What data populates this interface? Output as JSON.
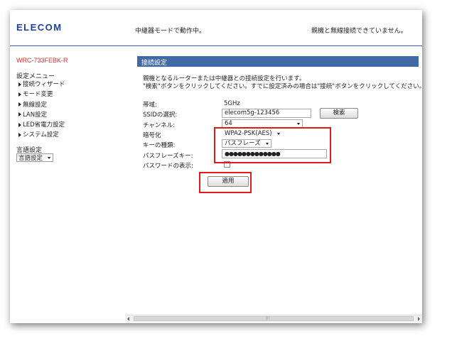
{
  "header": {
    "logo": "ELECOM",
    "mode_status": "中継器モードで動作中。",
    "connection_status": "親機と無線接続できていません。"
  },
  "sidebar": {
    "model": "WRC-733FEBK-R",
    "menu_title": "設定メニュー",
    "items": [
      {
        "label": "接続ウィザード"
      },
      {
        "label": "モード変更"
      },
      {
        "label": "無線設定"
      },
      {
        "label": "LAN設定"
      },
      {
        "label": "LED省電力設定"
      },
      {
        "label": "システム設定"
      }
    ],
    "language_label": "言語設定",
    "language_select": "言語設定"
  },
  "main": {
    "section_title": "接続設定",
    "description_line1": "親機となるルーターまたは中継器との接続設定を行います。",
    "description_line2": "\"検索\"ボタンをクリックしてください。すでに設定済みの場合は\"接続\"ボタンをクリックしてください。",
    "band_label": "帯域:",
    "band_value": "5GHz",
    "ssid_label": "SSIDの選択:",
    "ssid_value": "elecom5g-123456",
    "search_button": "検索",
    "channel_label": "チャンネル:",
    "channel_value": "64",
    "encryption_label": "暗号化",
    "encryption_value": "WPA2-PSK(AES)",
    "key_type_label": "キーの種類:",
    "key_type_value": "パスフレーズ",
    "passphrase_label": "パスフレーズキー:",
    "passphrase_value": "●●●●●●●●●●●●●",
    "show_password_label": "パスワードの表示:",
    "show_password_checked": false,
    "apply_button": "適用"
  },
  "colors": {
    "accent": "#3f6aa5",
    "logo": "#1d3f9a",
    "model": "#e03030",
    "highlight": "#e01b1b"
  }
}
